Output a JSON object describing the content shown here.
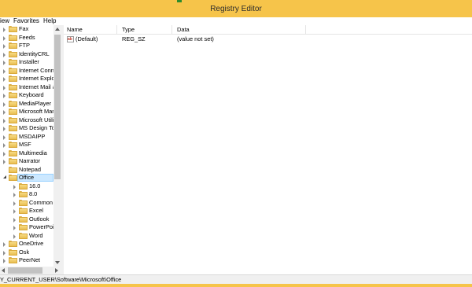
{
  "window": {
    "title": "Registry Editor"
  },
  "menubar": {
    "view_label": "iew",
    "favorites_label": "Favorites",
    "help_label": "Help"
  },
  "tree": {
    "items": [
      {
        "label": "Fax",
        "expanded": false
      },
      {
        "label": "Feeds",
        "expanded": false
      },
      {
        "label": "FTP",
        "expanded": false
      },
      {
        "label": "IdentityCRL",
        "expanded": false
      },
      {
        "label": "Installer",
        "expanded": false
      },
      {
        "label": "Internet Conne",
        "expanded": false
      },
      {
        "label": "Internet Explor",
        "expanded": false
      },
      {
        "label": "Internet Mail a",
        "expanded": false
      },
      {
        "label": "Keyboard",
        "expanded": false
      },
      {
        "label": "MediaPlayer",
        "expanded": false
      },
      {
        "label": "Microsoft Man",
        "expanded": false
      },
      {
        "label": "Microsoft Utili",
        "expanded": false
      },
      {
        "label": "MS Design Too",
        "expanded": false
      },
      {
        "label": "MSDAIPP",
        "expanded": false
      },
      {
        "label": "MSF",
        "expanded": false
      },
      {
        "label": "Multimedia",
        "expanded": false
      },
      {
        "label": "Narrator",
        "expanded": false
      },
      {
        "label": "Notepad",
        "expanded": false
      },
      {
        "label": "Office",
        "expanded": true,
        "selected": true
      },
      {
        "label": "16.0",
        "child": true
      },
      {
        "label": "8.0",
        "child": true
      },
      {
        "label": "Common",
        "child": true
      },
      {
        "label": "Excel",
        "child": true
      },
      {
        "label": "Outlook",
        "child": true
      },
      {
        "label": "PowerPoin",
        "child": true
      },
      {
        "label": "Word",
        "child": true
      },
      {
        "label": "OneDrive",
        "expanded": false
      },
      {
        "label": "Osk",
        "expanded": false
      },
      {
        "label": "PeerNet",
        "expanded": false
      }
    ]
  },
  "values_pane": {
    "columns": {
      "name": "Name",
      "type": "Type",
      "data": "Data"
    },
    "rows": [
      {
        "name": "(Default)",
        "type": "REG_SZ",
        "data": "(value not set)",
        "icon": "string-value-icon"
      }
    ]
  },
  "statusbar": {
    "path": "Y_CURRENT_USER\\Software\\Microsoft\\Office"
  },
  "colors": {
    "title_bar": "#f6c44a",
    "selection": "#cce8ff",
    "folder": "#e8be52"
  }
}
